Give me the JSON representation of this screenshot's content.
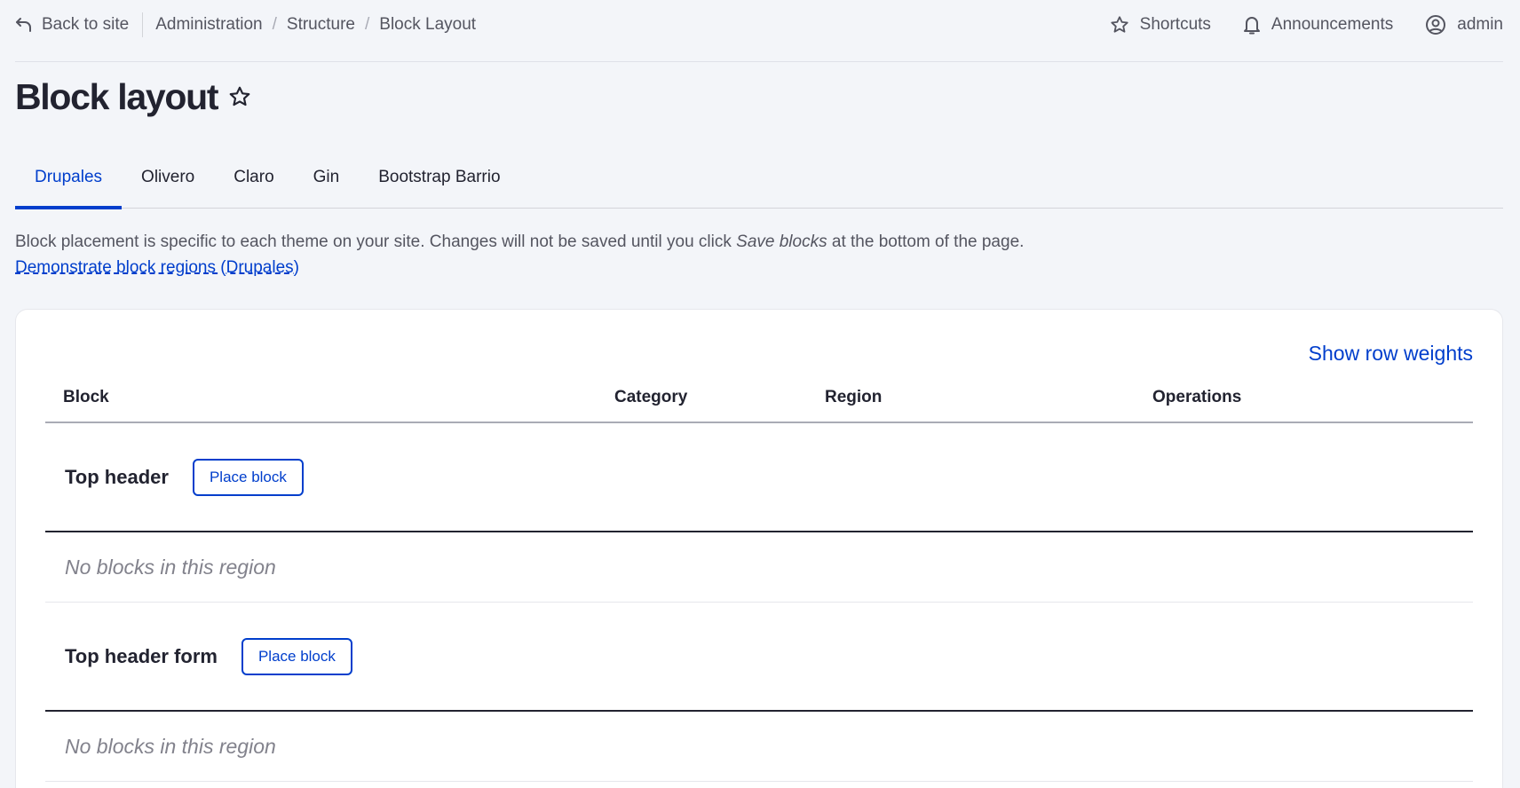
{
  "toolbar": {
    "back_label": "Back to site",
    "breadcrumbs": [
      "Administration",
      "Structure",
      "Block Layout"
    ],
    "shortcuts_label": "Shortcuts",
    "announcements_label": "Announcements",
    "user_label": "admin"
  },
  "page": {
    "title": "Block layout"
  },
  "tabs": [
    {
      "label": "Drupales",
      "active": true
    },
    {
      "label": "Olivero",
      "active": false
    },
    {
      "label": "Claro",
      "active": false
    },
    {
      "label": "Gin",
      "active": false
    },
    {
      "label": "Bootstrap Barrio",
      "active": false
    }
  ],
  "description": {
    "text_before": "Block placement is specific to each theme on your site. Changes will not be saved until you click ",
    "emphasis": "Save blocks",
    "text_after": " at the bottom of the page.",
    "demo_link": "Demonstrate block regions (Drupales)"
  },
  "table": {
    "row_weights_label": "Show row weights",
    "headers": {
      "block": "Block",
      "category": "Category",
      "region": "Region",
      "operations": "Operations"
    },
    "regions": [
      {
        "name": "Top header",
        "button": "Place block",
        "empty_text": "No blocks in this region"
      },
      {
        "name": "Top header form",
        "button": "Place block",
        "empty_text": "No blocks in this region"
      }
    ]
  },
  "colors": {
    "accent": "#003ecc",
    "text": "#222330",
    "muted": "#545560",
    "background": "#f3f5f9"
  }
}
